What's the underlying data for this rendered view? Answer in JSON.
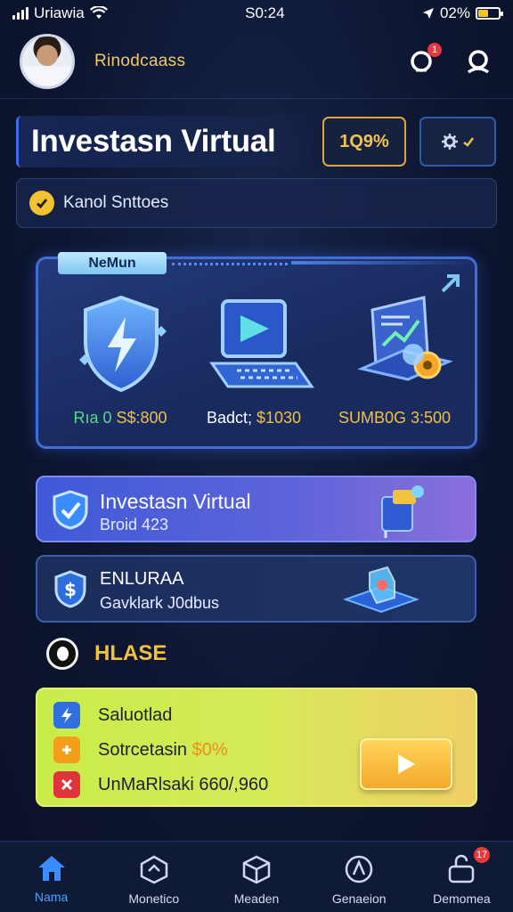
{
  "status_bar": {
    "carrier": "Uriawia",
    "time": "S0:24",
    "battery": "02%",
    "battery_level": 0.5
  },
  "header": {
    "user_name": "Rinodcaass",
    "notification_count": "1"
  },
  "title": {
    "text": "Investasn Virtual",
    "percent_badge": "1Q9%"
  },
  "status_card": {
    "text": "Kanol Snttoes"
  },
  "feature_panel": {
    "tag": "NeMun",
    "features": [
      {
        "icon": "shield-lightning-icon",
        "label_prefix": "Rıa 0 ",
        "label_value": "S$:800"
      },
      {
        "icon": "laptop-play-icon",
        "label_prefix": "Badct; ",
        "label_value": "$1030"
      },
      {
        "icon": "chart-gear-icon",
        "label_prefix": "",
        "label_value": "SUMB0G 3:500"
      }
    ]
  },
  "card_virtual": {
    "title": "Investasn Virtual",
    "subtitle": "Broid 423"
  },
  "card_enluraa": {
    "title": "ENLURAA",
    "subtitle": "Gavklark J0dbus"
  },
  "hlase": {
    "label": "HLASE"
  },
  "promo": {
    "rows": [
      {
        "icon": "lightning-icon",
        "text": "Saluotlad",
        "highlight": ""
      },
      {
        "icon": "coin-icon",
        "text": "Sotrcetasin ",
        "highlight": "$0%"
      },
      {
        "icon": "close-icon",
        "text": "UnMaRlsaki 660/,960",
        "highlight": ""
      }
    ]
  },
  "bottom_nav": {
    "items": [
      {
        "label": "Nama",
        "active": true
      },
      {
        "label": "Monetico",
        "active": false
      },
      {
        "label": "Meaden",
        "active": false
      },
      {
        "label": "Genaeion",
        "active": false
      },
      {
        "label": "Demomea",
        "active": false,
        "badge": "17"
      }
    ]
  },
  "colors": {
    "accent_blue": "#3f6ed8",
    "gold": "#f1c23d",
    "alert_red": "#e5383b"
  }
}
